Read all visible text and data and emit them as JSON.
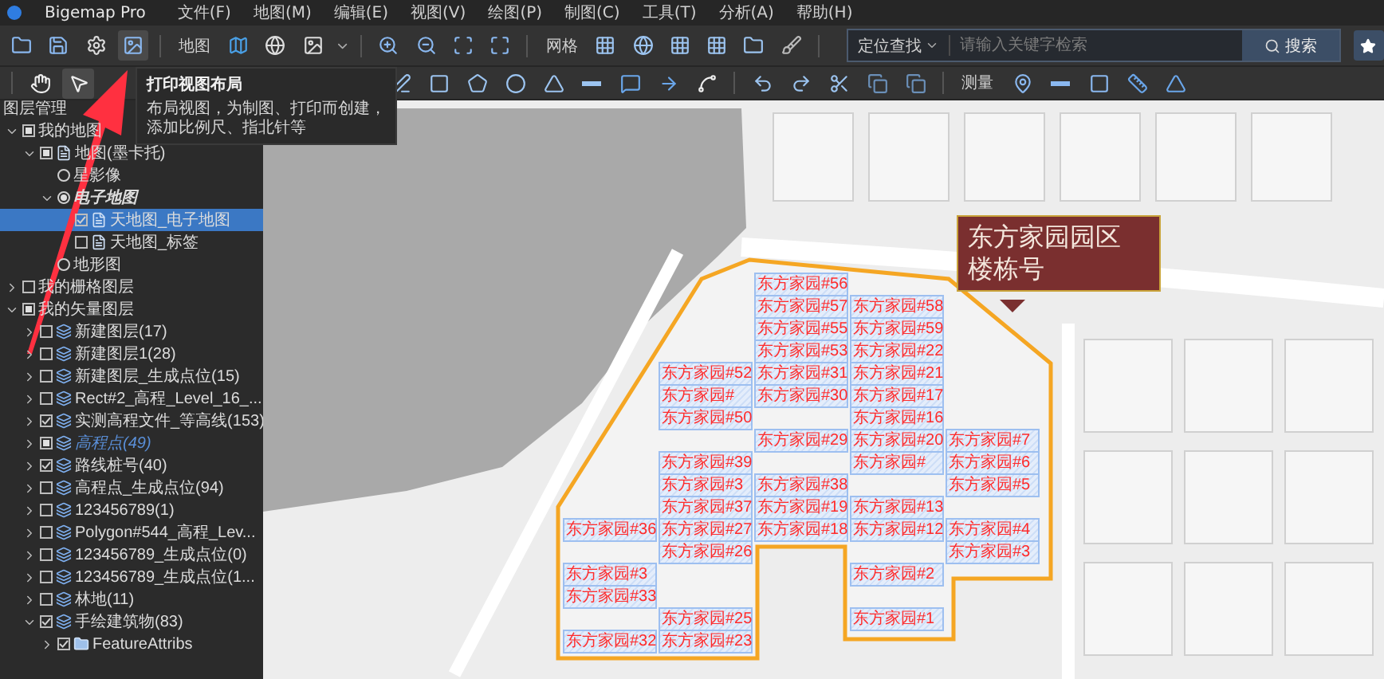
{
  "app": {
    "title": "Bigemap Pro",
    "menu": [
      "文件(F)",
      "地图(M)",
      "编辑(E)",
      "视图(V)",
      "绘图(P)",
      "制图(C)",
      "工具(T)",
      "分析(A)",
      "帮助(H)"
    ]
  },
  "main_toolbar": {
    "print_layout_selected": true,
    "map_label": "地图",
    "grid_label": "网格"
  },
  "search": {
    "scope": "定位查找",
    "placeholder": "请输入关键字检索",
    "button": "搜索"
  },
  "draw_toolbar": {
    "pointer_tools": [
      {
        "selected": false
      },
      {
        "selected": true
      }
    ],
    "measure_label": "测量"
  },
  "tooltip": {
    "title": "打印视图布局",
    "text": "布局视图，为制图、打印而创建，添加比例尺、指北针等"
  },
  "layers_panel": {
    "title": "图层管理",
    "tree": [
      {
        "label": "我的地图",
        "kind": "group",
        "checked": false,
        "partial": true,
        "expanded": true,
        "selected": false,
        "active": false,
        "editing": false,
        "children": [
          {
            "label": "地图(墨卡托)",
            "kind": "basemap",
            "checked": false,
            "partial": true,
            "expanded": true,
            "selected": false,
            "active": false,
            "editing": false,
            "children": [
              {
                "label": "星影像",
                "kind": "radio",
                "checked": false,
                "selected": false,
                "active": false,
                "editing": false
              },
              {
                "label": "电子地图",
                "kind": "radio",
                "checked": true,
                "expanded": true,
                "selected": false,
                "active": true,
                "editing": false,
                "children": [
                  {
                    "label": "天地图_电子地图",
                    "kind": "basemap",
                    "checked": true,
                    "partial": false,
                    "selected": true,
                    "active": false,
                    "editing": false
                  },
                  {
                    "label": "天地图_标签",
                    "kind": "basemap",
                    "checked": false,
                    "partial": false,
                    "selected": false,
                    "active": false,
                    "editing": false
                  }
                ]
              },
              {
                "label": "地形图",
                "kind": "radio",
                "checked": false,
                "selected": false,
                "active": false,
                "editing": false
              }
            ]
          }
        ]
      },
      {
        "label": "我的栅格图层",
        "kind": "group",
        "checked": false,
        "partial": false,
        "expanded": false,
        "selected": false,
        "active": false,
        "editing": false
      },
      {
        "label": "我的矢量图层",
        "kind": "group",
        "checked": false,
        "partial": true,
        "expanded": true,
        "selected": false,
        "active": false,
        "editing": false,
        "children": [
          {
            "label": "新建图层(17)",
            "kind": "layer",
            "checked": false,
            "partial": false,
            "expanded": false,
            "selected": false,
            "active": false,
            "editing": false
          },
          {
            "label": "新建图层1(28)",
            "kind": "layer",
            "checked": false,
            "partial": false,
            "expanded": false,
            "selected": false,
            "active": false,
            "editing": false
          },
          {
            "label": "新建图层_生成点位(15)",
            "kind": "layer",
            "checked": false,
            "partial": false,
            "expanded": false,
            "selected": false,
            "active": false,
            "editing": false
          },
          {
            "label": "Rect#2_高程_Level_16_...",
            "kind": "layer",
            "checked": false,
            "partial": false,
            "expanded": false,
            "selected": false,
            "active": false,
            "editing": false
          },
          {
            "label": "实测高程文件_等高线(153)",
            "kind": "layer",
            "checked": true,
            "partial": false,
            "expanded": false,
            "selected": false,
            "active": false,
            "editing": false
          },
          {
            "label": "高程点(49)",
            "kind": "layer",
            "checked": false,
            "partial": true,
            "expanded": false,
            "selected": false,
            "active": false,
            "editing": true
          },
          {
            "label": "路线桩号(40)",
            "kind": "layer",
            "checked": true,
            "partial": false,
            "expanded": false,
            "selected": false,
            "active": false,
            "editing": false
          },
          {
            "label": "高程点_生成点位(94)",
            "kind": "layer",
            "checked": false,
            "partial": false,
            "expanded": false,
            "selected": false,
            "active": false,
            "editing": false
          },
          {
            "label": "123456789(1)",
            "kind": "layer",
            "checked": false,
            "partial": false,
            "expanded": false,
            "selected": false,
            "active": false,
            "editing": false
          },
          {
            "label": "Polygon#544_高程_Lev...",
            "kind": "layer",
            "checked": false,
            "partial": false,
            "expanded": false,
            "selected": false,
            "active": false,
            "editing": false
          },
          {
            "label": "123456789_生成点位(0)",
            "kind": "layer",
            "checked": false,
            "partial": false,
            "expanded": false,
            "selected": false,
            "active": false,
            "editing": false
          },
          {
            "label": "123456789_生成点位(1...",
            "kind": "layer",
            "checked": false,
            "partial": false,
            "expanded": false,
            "selected": false,
            "active": false,
            "editing": false
          },
          {
            "label": "林地(11)",
            "kind": "layer",
            "checked": false,
            "partial": false,
            "expanded": false,
            "selected": false,
            "active": false,
            "editing": false
          },
          {
            "label": "手绘建筑物(83)",
            "kind": "layer",
            "checked": true,
            "partial": false,
            "expanded": true,
            "selected": false,
            "active": false,
            "editing": false,
            "children": [
              {
                "label": "FeatureAttribs",
                "kind": "folder",
                "checked": true,
                "partial": false,
                "expanded": false,
                "selected": false,
                "active": false,
                "editing": false
              }
            ]
          }
        ]
      }
    ]
  },
  "map": {
    "callout": [
      "东方家园园区",
      "楼栋号"
    ],
    "labels": [
      "东方家园#56",
      "东方家园#57",
      "东方家园#58",
      "东方家园#55",
      "东方家园#59",
      "东方家园#53",
      "东方家园#22",
      "东方家园#52",
      "东方家园#31",
      "东方家园#21",
      "东方家园#",
      "东方家园#30",
      "东方家园#17",
      "东方家园#50",
      "东方家园#16",
      "东方家园#29",
      "东方家园#20",
      "东方家园#7",
      "东方家园#39",
      "东方家园#",
      "东方家园#6",
      "东方家园#3",
      "东方家园#38",
      "东方家园#5",
      "东方家园#37",
      "东方家园#19",
      "东方家园#13",
      "东方家园#36",
      "东方家园#27",
      "东方家园#18",
      "东方家园#12",
      "东方家园#4",
      "东方家园#26",
      "东方家园#3",
      "东方家园#3",
      "东方家园#2",
      "东方家园#33",
      "东方家园#25",
      "东方家园#1",
      "东方家园#32",
      "东方家园#23"
    ]
  }
}
